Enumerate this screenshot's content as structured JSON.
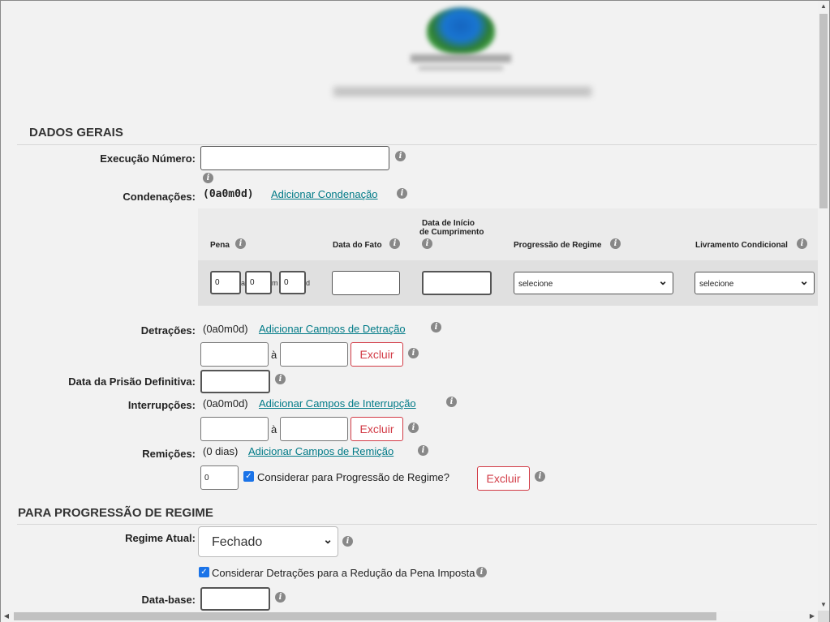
{
  "sections": {
    "dados_gerais": "DADOS GERAIS",
    "progressao": "PARA PROGRESSÃO DE REGIME"
  },
  "execucao": {
    "label": "Execução Número:",
    "value": ""
  },
  "condenacoes": {
    "label": "Condenações:",
    "summary": "(0a0m0d)",
    "add_link": "Adicionar Condenação",
    "headers": {
      "pena": "Pena",
      "data_fato": "Data do Fato",
      "data_inicio_1": "Data de Início",
      "data_inicio_2": "de Cumprimento",
      "progressao": "Progressão de Regime",
      "livramento": "Livramento Condicional"
    },
    "row": {
      "anos": "0",
      "meses": "0",
      "dias": "0",
      "unit_a": "a",
      "unit_m": "m",
      "unit_d": "d",
      "data_fato": "",
      "data_inicio": "",
      "progressao_selected": "selecione",
      "livramento_selected": "selecione"
    }
  },
  "detracoes": {
    "label": "Detrações:",
    "summary": "(0a0m0d)",
    "add_link": "Adicionar Campos de Detração",
    "separator": "à",
    "excluir": "Excluir"
  },
  "prisao_definitiva": {
    "label": "Data da Prisão Definitiva:",
    "value": ""
  },
  "interrupcoes": {
    "label": "Interrupções:",
    "summary": "(0a0m0d)",
    "add_link": "Adicionar Campos de Interrupção",
    "separator": "à",
    "excluir": "Excluir"
  },
  "remicoes": {
    "label": "Remições:",
    "summary": "(0 dias)",
    "add_link": "Adicionar Campos de Remição",
    "value": "0",
    "checkbox_label": "Considerar para Progressão de Regime?",
    "excluir": "Excluir"
  },
  "regime_atual": {
    "label": "Regime Atual:",
    "selected": "Fechado"
  },
  "considerar_detracoes": {
    "label": "Considerar Detrações para a Redução da Pena Imposta"
  },
  "data_base": {
    "label": "Data-base:",
    "value": ""
  },
  "icons": {
    "info": "i",
    "check": "✓",
    "chevron": "⌄",
    "scroll_up": "▲",
    "scroll_down": "▼",
    "scroll_left": "◀",
    "scroll_right": "▶"
  },
  "colors": {
    "link": "#007a87",
    "danger": "#d23b46",
    "checkbox": "#1a73e8"
  }
}
